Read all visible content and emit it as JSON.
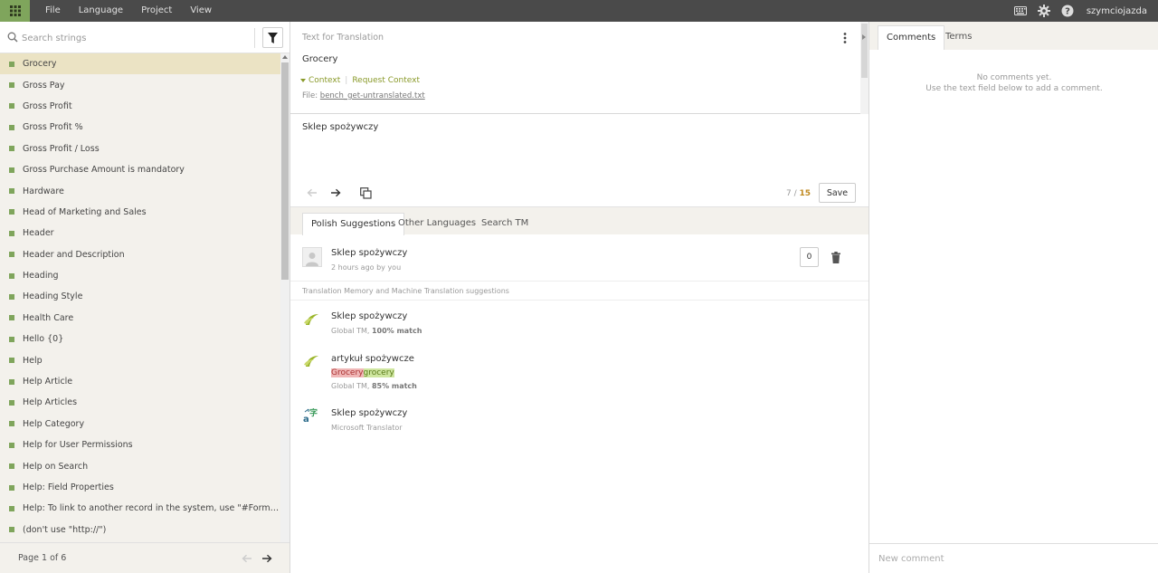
{
  "menu": [
    "File",
    "Language",
    "Project",
    "View"
  ],
  "user": {
    "name": "szymciojazda"
  },
  "search": {
    "placeholder": "Search strings"
  },
  "strings": [
    "Grocery",
    "Gross Pay",
    "Gross Profit",
    "Gross Profit %",
    "Gross Profit / Loss",
    "Gross Purchase Amount is mandatory",
    "Hardware",
    "Head of Marketing and Sales",
    "Header",
    "Header and Description",
    "Heading",
    "Heading Style",
    "Health Care",
    "Hello {0}",
    "Help",
    "Help Article",
    "Help Articles",
    "Help Category",
    "Help for User Permissions",
    "Help on Search",
    "Help: Field Properties",
    "Help: To link to another record in the system, use \"#Form/Note/[N...",
    "(don't use \"http://\")"
  ],
  "pager": {
    "label": "Page 1 of 6"
  },
  "source": {
    "label": "Text for Translation",
    "text": "Grocery",
    "context_label": "Context",
    "request_context_label": "Request Context",
    "file_prefix": "File:",
    "file_name": "bench_get-untranslated.txt"
  },
  "translation": {
    "value": "Sklep spożywczy"
  },
  "counter": {
    "current": "7",
    "sep": " / ",
    "total": "15"
  },
  "save_label": "Save",
  "tabs": [
    "Polish Suggestions",
    "Other Languages",
    "Search TM"
  ],
  "user_suggestion": {
    "text": "Sklep spożywczy",
    "meta": "2 hours ago by you",
    "votes": "0"
  },
  "tm_section_label": "Translation Memory and Machine Translation suggestions",
  "tm_suggestions": [
    {
      "text": "Sklep spożywczy",
      "source": "Global TM, ",
      "match": "100% match"
    },
    {
      "text": "artykuł spożywcze",
      "diff_del": "Grocery",
      "diff_ins": "grocery",
      "source": "Global TM, ",
      "match": "85% match"
    }
  ],
  "mt_suggestion": {
    "text": "Sklep spożywczy",
    "source": "Microsoft Translator"
  },
  "right_tabs": [
    "Comments",
    "Terms"
  ],
  "comments": {
    "empty_line1": "No comments yet.",
    "empty_line2": "Use the text field below to add a comment.",
    "placeholder": "New comment"
  },
  "colors": {
    "accent": "#7fa55c",
    "topbar": "#4a4a4a",
    "active_row": "#ebe3c4",
    "link": "#8a9a2a"
  }
}
